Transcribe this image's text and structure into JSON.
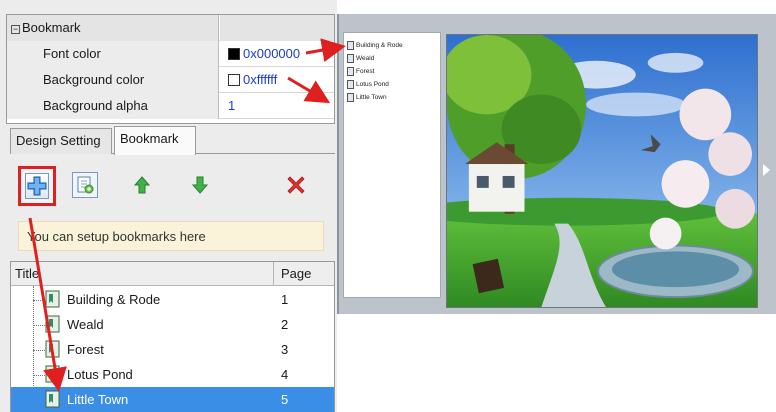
{
  "properties": {
    "section_label": "Bookmark",
    "rows": [
      {
        "label": "Font color",
        "value": "0x000000",
        "swatch": "#000000"
      },
      {
        "label": "Background color",
        "value": "0xffffff",
        "swatch": "#ffffff"
      },
      {
        "label": "Background alpha",
        "value": "1"
      }
    ]
  },
  "tabs": [
    {
      "label": "Design Setting"
    },
    {
      "label": "Bookmark",
      "active": true
    }
  ],
  "toolbar": {
    "icons": [
      "add-bookmark-icon",
      "add-sub-bookmark-icon",
      "move-up-icon",
      "move-down-icon",
      "delete-icon"
    ]
  },
  "hint": "You can setup bookmarks here",
  "tree": {
    "col_title": "Title",
    "col_page": "Page",
    "items": [
      {
        "title": "Building & Rode",
        "page": "1"
      },
      {
        "title": "Weald",
        "page": "2"
      },
      {
        "title": "Forest",
        "page": "3"
      },
      {
        "title": "Lotus Pond",
        "page": "4"
      },
      {
        "title": "Little Town",
        "page": "5",
        "selected": true
      }
    ]
  },
  "preview": {
    "bookmarks": [
      "Building & Rode",
      "Weald",
      "Forest",
      "Lotus Pond",
      "Little Town"
    ]
  },
  "colors": {
    "accent_red": "#e02020",
    "selection_blue": "#3a8ee6",
    "value_blue": "#1a3dcc",
    "hint_bg": "#fbf3d9"
  }
}
